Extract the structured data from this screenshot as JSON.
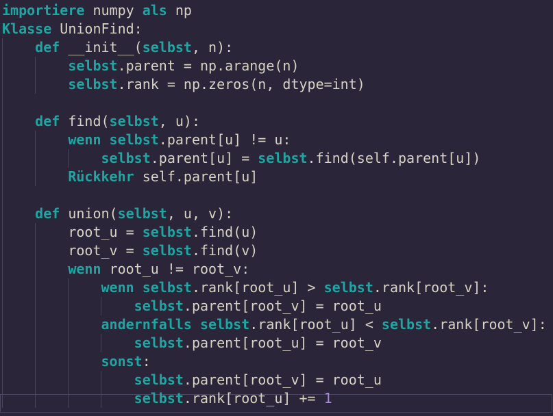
{
  "editor": {
    "lines": [
      [
        {
          "t": "importiere",
          "k": "kw"
        },
        {
          "t": " numpy "
        },
        {
          "t": "als",
          "k": "kw"
        },
        {
          "t": " np"
        }
      ],
      [
        {
          "t": "Klasse",
          "k": "kw"
        },
        {
          "t": " UnionFind:"
        }
      ],
      [
        {
          "t": "    "
        },
        {
          "t": "def",
          "k": "kw"
        },
        {
          "t": " __init__("
        },
        {
          "t": "selbst",
          "k": "kw"
        },
        {
          "t": ", n):"
        }
      ],
      [
        {
          "t": "        "
        },
        {
          "t": "selbst",
          "k": "kw"
        },
        {
          "t": ".parent = np.arange(n)"
        }
      ],
      [
        {
          "t": "        "
        },
        {
          "t": "selbst",
          "k": "kw"
        },
        {
          "t": ".rank = np.zeros(n, dtype=int)"
        }
      ],
      [],
      [
        {
          "t": "    "
        },
        {
          "t": "def",
          "k": "kw"
        },
        {
          "t": " find("
        },
        {
          "t": "selbst",
          "k": "kw"
        },
        {
          "t": ", u):"
        }
      ],
      [
        {
          "t": "        "
        },
        {
          "t": "wenn",
          "k": "kw"
        },
        {
          "t": " "
        },
        {
          "t": "selbst",
          "k": "kw"
        },
        {
          "t": ".parent[u] != u:"
        }
      ],
      [
        {
          "t": "            "
        },
        {
          "t": "selbst",
          "k": "kw"
        },
        {
          "t": ".parent[u] = "
        },
        {
          "t": "selbst",
          "k": "kw"
        },
        {
          "t": ".find(self.parent[u])"
        }
      ],
      [
        {
          "t": "        "
        },
        {
          "t": "Rückkehr",
          "k": "kw"
        },
        {
          "t": " self.parent[u]"
        }
      ],
      [],
      [
        {
          "t": "    "
        },
        {
          "t": "def",
          "k": "kw"
        },
        {
          "t": " union("
        },
        {
          "t": "selbst",
          "k": "kw"
        },
        {
          "t": ", u, v):"
        }
      ],
      [
        {
          "t": "        root_u = "
        },
        {
          "t": "selbst",
          "k": "kw"
        },
        {
          "t": ".find(u)"
        }
      ],
      [
        {
          "t": "        root_v = "
        },
        {
          "t": "selbst",
          "k": "kw"
        },
        {
          "t": ".find(v)"
        }
      ],
      [
        {
          "t": "        "
        },
        {
          "t": "wenn",
          "k": "kw"
        },
        {
          "t": " root_u != root_v:"
        }
      ],
      [
        {
          "t": "            "
        },
        {
          "t": "wenn",
          "k": "kw"
        },
        {
          "t": " "
        },
        {
          "t": "selbst",
          "k": "kw"
        },
        {
          "t": ".rank[root_u] > "
        },
        {
          "t": "selbst",
          "k": "kw"
        },
        {
          "t": ".rank[root_v]:"
        }
      ],
      [
        {
          "t": "                "
        },
        {
          "t": "selbst",
          "k": "kw"
        },
        {
          "t": ".parent[root_v] = root_u"
        }
      ],
      [
        {
          "t": "            "
        },
        {
          "t": "andernfalls",
          "k": "kw"
        },
        {
          "t": " "
        },
        {
          "t": "selbst",
          "k": "kw"
        },
        {
          "t": ".rank[root_u] < "
        },
        {
          "t": "selbst",
          "k": "kw"
        },
        {
          "t": ".rank[root_v]:"
        }
      ],
      [
        {
          "t": "                "
        },
        {
          "t": "selbst",
          "k": "kw"
        },
        {
          "t": ".parent[root_u] = root_v"
        }
      ],
      [
        {
          "t": "            "
        },
        {
          "t": "sonst",
          "k": "kw"
        },
        {
          "t": ":"
        }
      ],
      [
        {
          "t": "                "
        },
        {
          "t": "selbst",
          "k": "kw"
        },
        {
          "t": ".parent[root_v] = root_u"
        }
      ],
      [
        {
          "t": "                "
        },
        {
          "t": "selbst",
          "k": "kw"
        },
        {
          "t": ".rank[root_u] += "
        },
        {
          "t": "1",
          "k": "num"
        }
      ]
    ]
  },
  "colors": {
    "background": "#2a2539",
    "text": "#d8d2c4",
    "keyword": "#1fa6a2",
    "number": "#a78bdb",
    "indent_guide": "#4a4458",
    "current_line_border": "#4e4862"
  }
}
